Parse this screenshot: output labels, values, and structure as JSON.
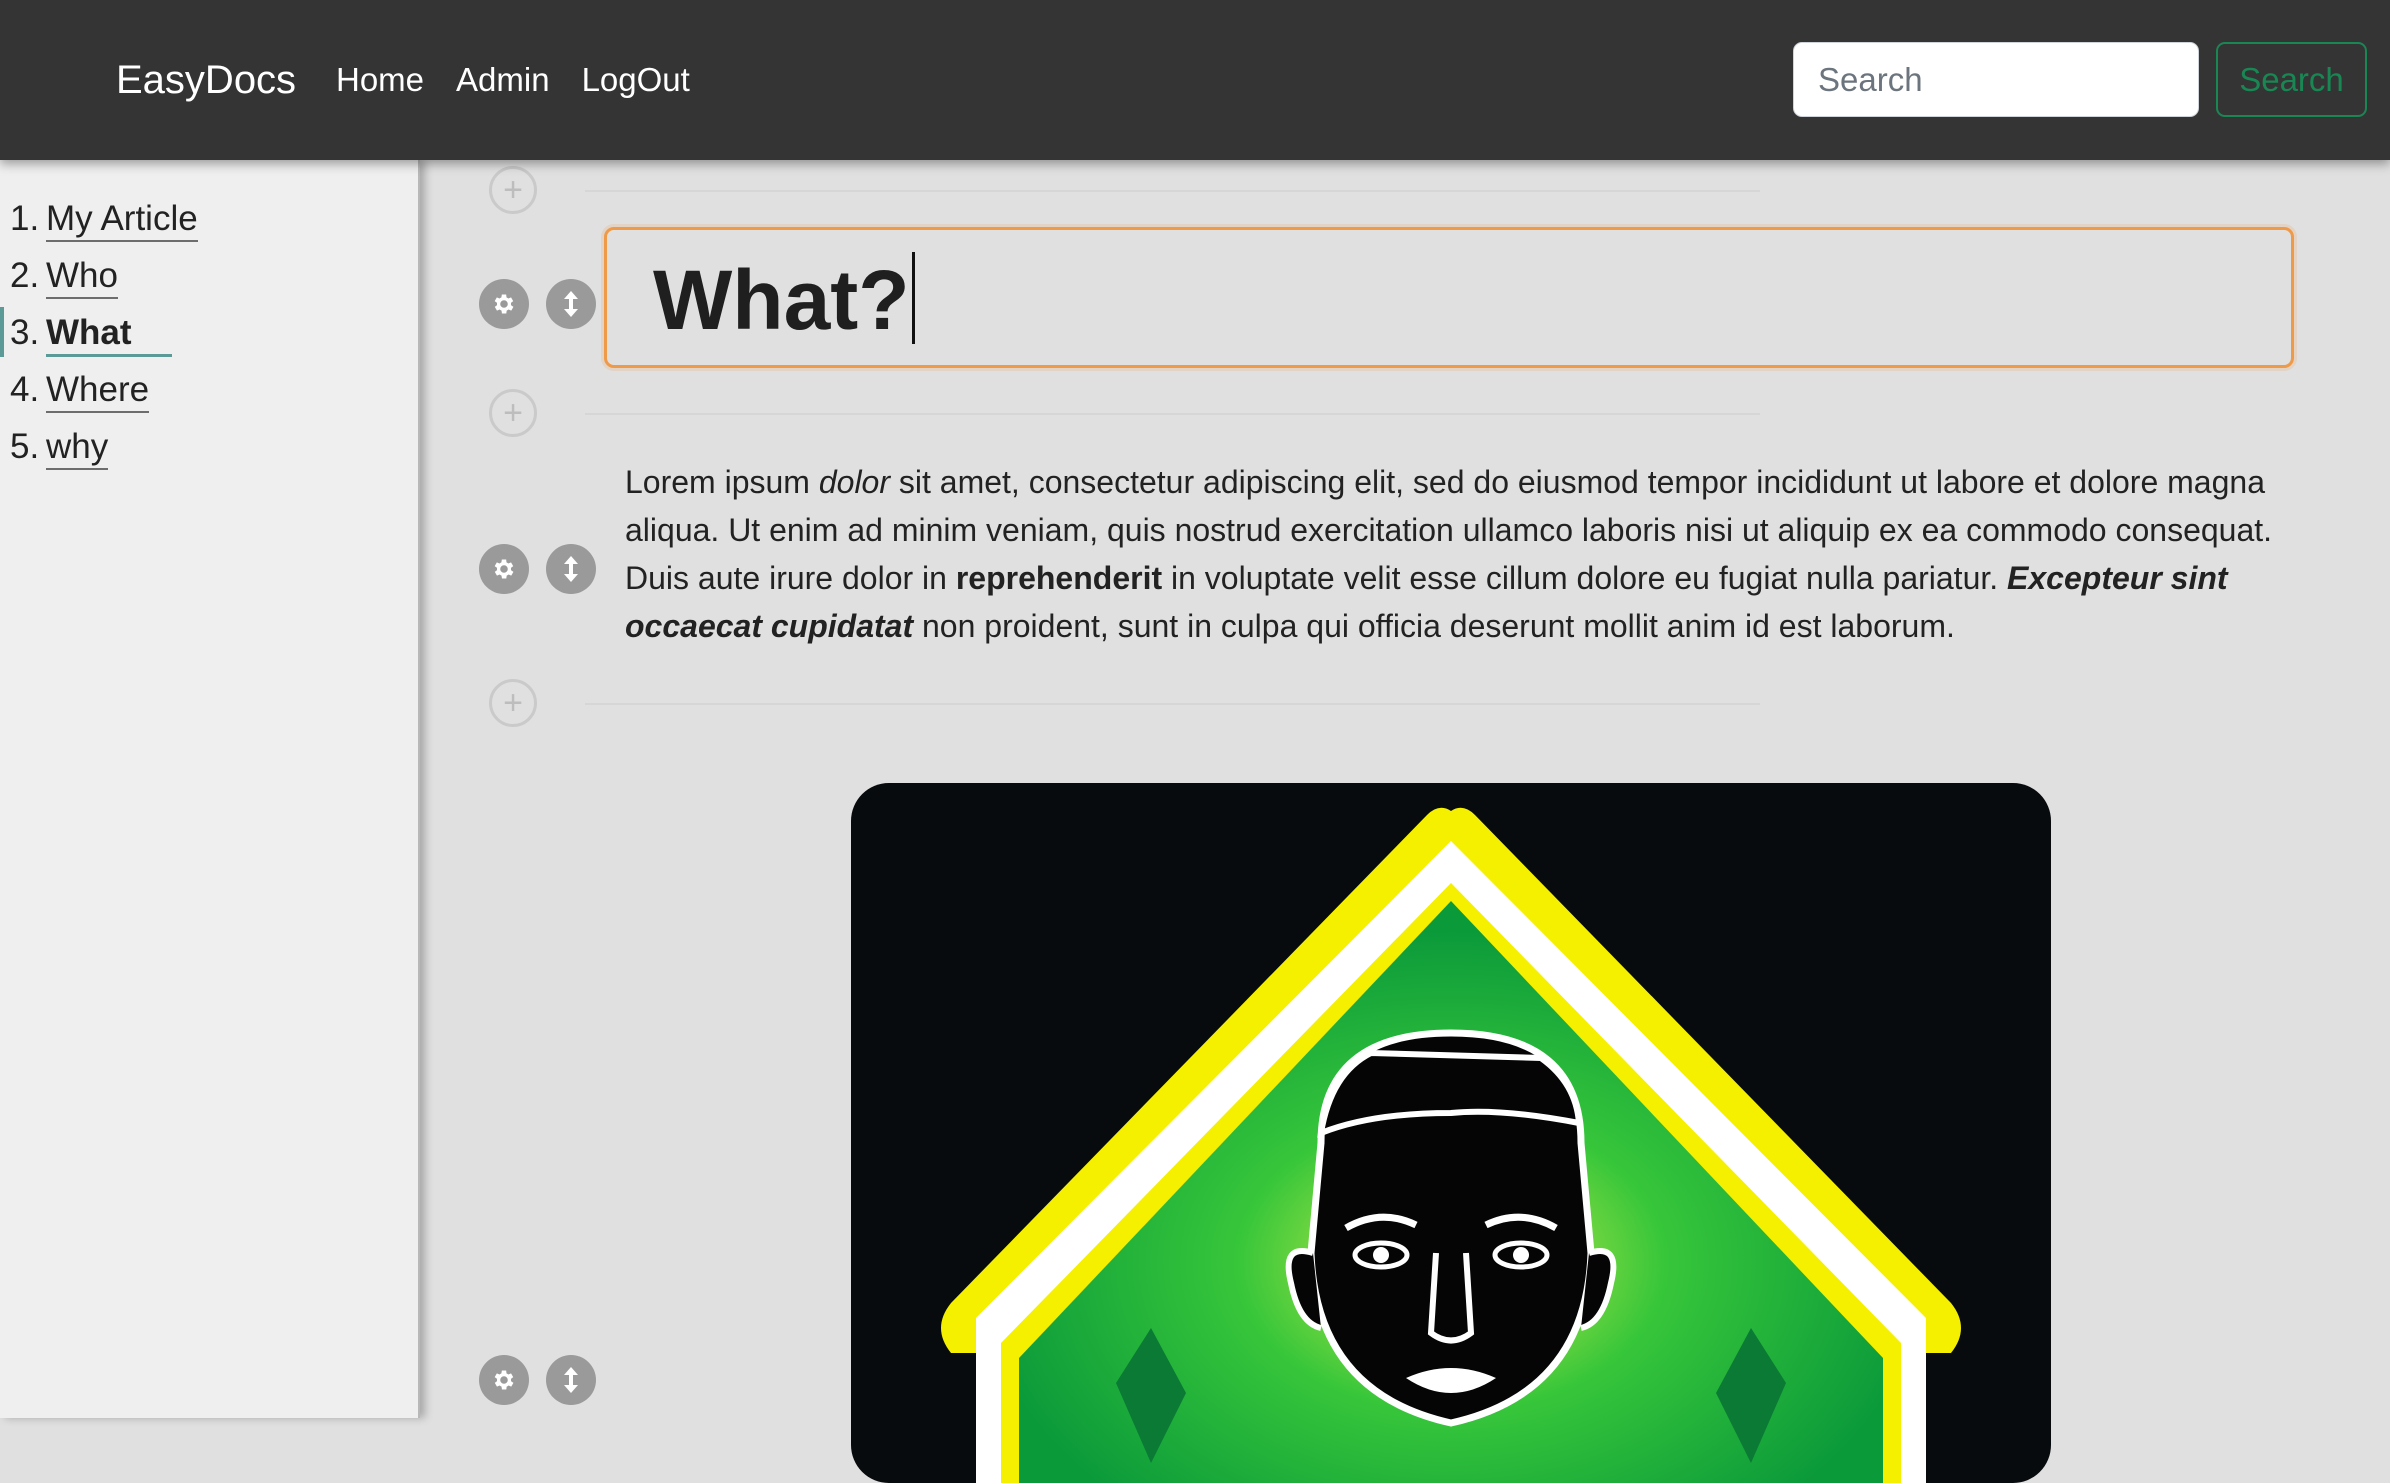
{
  "navbar": {
    "brand": "EasyDocs",
    "links": [
      "Home",
      "Admin",
      "LogOut"
    ],
    "search_placeholder": "Search",
    "search_button": "Search",
    "search_button_color": "#198754"
  },
  "sidebar": {
    "items": [
      {
        "number": "1.",
        "label": "My Article"
      },
      {
        "number": "2.",
        "label": "Who"
      },
      {
        "number": "3.",
        "label": "What",
        "active": true
      },
      {
        "number": "4.",
        "label": "Where"
      },
      {
        "number": "5.",
        "label": "why"
      }
    ],
    "active_color": "#5b9a96"
  },
  "editor": {
    "heading": "What?",
    "heading_border_color": "#ee9a49",
    "paragraph": {
      "p1": "Lorem ipsum ",
      "p2_italic": "dolor",
      "p3": " sit amet, consectetur adipiscing elit, sed do eiusmod tempor incididunt ut labore et dolore magna aliqua. Ut enim ad minim veniam, quis nostrud exercitation ullamco laboris nisi ut aliquip ex ea commodo consequat. Duis aute irure dolor in ",
      "p4_bold": "reprehenderit",
      "p5": " in voluptate velit esse cillum dolore eu fugiat nulla pariatur. ",
      "p6_bold_italic": "Excepteur sint occaecat cupidatat",
      "p7": " non proident, sunt in culpa qui officia deserunt mollit anim id est laborum."
    },
    "icons": {
      "add": "plus-circle-icon",
      "settings": "gear-icon",
      "move": "up-down-arrow-icon"
    },
    "add_symbol": "+",
    "image_colors": {
      "background": "#070b0d",
      "sign_green": "#12a83c",
      "sign_yellow": "#f5ef00"
    }
  }
}
